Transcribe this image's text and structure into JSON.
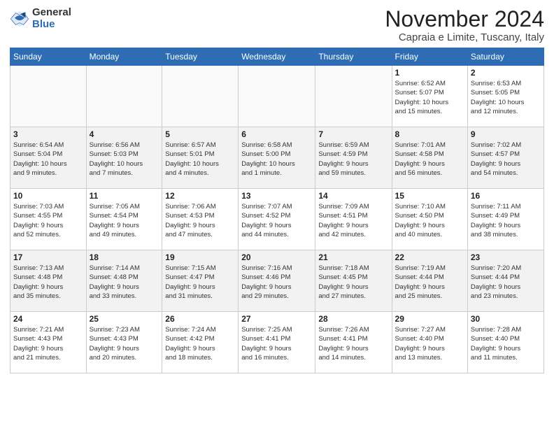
{
  "logo": {
    "general": "General",
    "blue": "Blue"
  },
  "header": {
    "title": "November 2024",
    "subtitle": "Capraia e Limite, Tuscany, Italy"
  },
  "weekdays": [
    "Sunday",
    "Monday",
    "Tuesday",
    "Wednesday",
    "Thursday",
    "Friday",
    "Saturday"
  ],
  "weeks": [
    [
      {
        "day": "",
        "info": ""
      },
      {
        "day": "",
        "info": ""
      },
      {
        "day": "",
        "info": ""
      },
      {
        "day": "",
        "info": ""
      },
      {
        "day": "",
        "info": ""
      },
      {
        "day": "1",
        "info": "Sunrise: 6:52 AM\nSunset: 5:07 PM\nDaylight: 10 hours\nand 15 minutes."
      },
      {
        "day": "2",
        "info": "Sunrise: 6:53 AM\nSunset: 5:05 PM\nDaylight: 10 hours\nand 12 minutes."
      }
    ],
    [
      {
        "day": "3",
        "info": "Sunrise: 6:54 AM\nSunset: 5:04 PM\nDaylight: 10 hours\nand 9 minutes."
      },
      {
        "day": "4",
        "info": "Sunrise: 6:56 AM\nSunset: 5:03 PM\nDaylight: 10 hours\nand 7 minutes."
      },
      {
        "day": "5",
        "info": "Sunrise: 6:57 AM\nSunset: 5:01 PM\nDaylight: 10 hours\nand 4 minutes."
      },
      {
        "day": "6",
        "info": "Sunrise: 6:58 AM\nSunset: 5:00 PM\nDaylight: 10 hours\nand 1 minute."
      },
      {
        "day": "7",
        "info": "Sunrise: 6:59 AM\nSunset: 4:59 PM\nDaylight: 9 hours\nand 59 minutes."
      },
      {
        "day": "8",
        "info": "Sunrise: 7:01 AM\nSunset: 4:58 PM\nDaylight: 9 hours\nand 56 minutes."
      },
      {
        "day": "9",
        "info": "Sunrise: 7:02 AM\nSunset: 4:57 PM\nDaylight: 9 hours\nand 54 minutes."
      }
    ],
    [
      {
        "day": "10",
        "info": "Sunrise: 7:03 AM\nSunset: 4:55 PM\nDaylight: 9 hours\nand 52 minutes."
      },
      {
        "day": "11",
        "info": "Sunrise: 7:05 AM\nSunset: 4:54 PM\nDaylight: 9 hours\nand 49 minutes."
      },
      {
        "day": "12",
        "info": "Sunrise: 7:06 AM\nSunset: 4:53 PM\nDaylight: 9 hours\nand 47 minutes."
      },
      {
        "day": "13",
        "info": "Sunrise: 7:07 AM\nSunset: 4:52 PM\nDaylight: 9 hours\nand 44 minutes."
      },
      {
        "day": "14",
        "info": "Sunrise: 7:09 AM\nSunset: 4:51 PM\nDaylight: 9 hours\nand 42 minutes."
      },
      {
        "day": "15",
        "info": "Sunrise: 7:10 AM\nSunset: 4:50 PM\nDaylight: 9 hours\nand 40 minutes."
      },
      {
        "day": "16",
        "info": "Sunrise: 7:11 AM\nSunset: 4:49 PM\nDaylight: 9 hours\nand 38 minutes."
      }
    ],
    [
      {
        "day": "17",
        "info": "Sunrise: 7:13 AM\nSunset: 4:48 PM\nDaylight: 9 hours\nand 35 minutes."
      },
      {
        "day": "18",
        "info": "Sunrise: 7:14 AM\nSunset: 4:48 PM\nDaylight: 9 hours\nand 33 minutes."
      },
      {
        "day": "19",
        "info": "Sunrise: 7:15 AM\nSunset: 4:47 PM\nDaylight: 9 hours\nand 31 minutes."
      },
      {
        "day": "20",
        "info": "Sunrise: 7:16 AM\nSunset: 4:46 PM\nDaylight: 9 hours\nand 29 minutes."
      },
      {
        "day": "21",
        "info": "Sunrise: 7:18 AM\nSunset: 4:45 PM\nDaylight: 9 hours\nand 27 minutes."
      },
      {
        "day": "22",
        "info": "Sunrise: 7:19 AM\nSunset: 4:44 PM\nDaylight: 9 hours\nand 25 minutes."
      },
      {
        "day": "23",
        "info": "Sunrise: 7:20 AM\nSunset: 4:44 PM\nDaylight: 9 hours\nand 23 minutes."
      }
    ],
    [
      {
        "day": "24",
        "info": "Sunrise: 7:21 AM\nSunset: 4:43 PM\nDaylight: 9 hours\nand 21 minutes."
      },
      {
        "day": "25",
        "info": "Sunrise: 7:23 AM\nSunset: 4:43 PM\nDaylight: 9 hours\nand 20 minutes."
      },
      {
        "day": "26",
        "info": "Sunrise: 7:24 AM\nSunset: 4:42 PM\nDaylight: 9 hours\nand 18 minutes."
      },
      {
        "day": "27",
        "info": "Sunrise: 7:25 AM\nSunset: 4:41 PM\nDaylight: 9 hours\nand 16 minutes."
      },
      {
        "day": "28",
        "info": "Sunrise: 7:26 AM\nSunset: 4:41 PM\nDaylight: 9 hours\nand 14 minutes."
      },
      {
        "day": "29",
        "info": "Sunrise: 7:27 AM\nSunset: 4:40 PM\nDaylight: 9 hours\nand 13 minutes."
      },
      {
        "day": "30",
        "info": "Sunrise: 7:28 AM\nSunset: 4:40 PM\nDaylight: 9 hours\nand 11 minutes."
      }
    ]
  ]
}
